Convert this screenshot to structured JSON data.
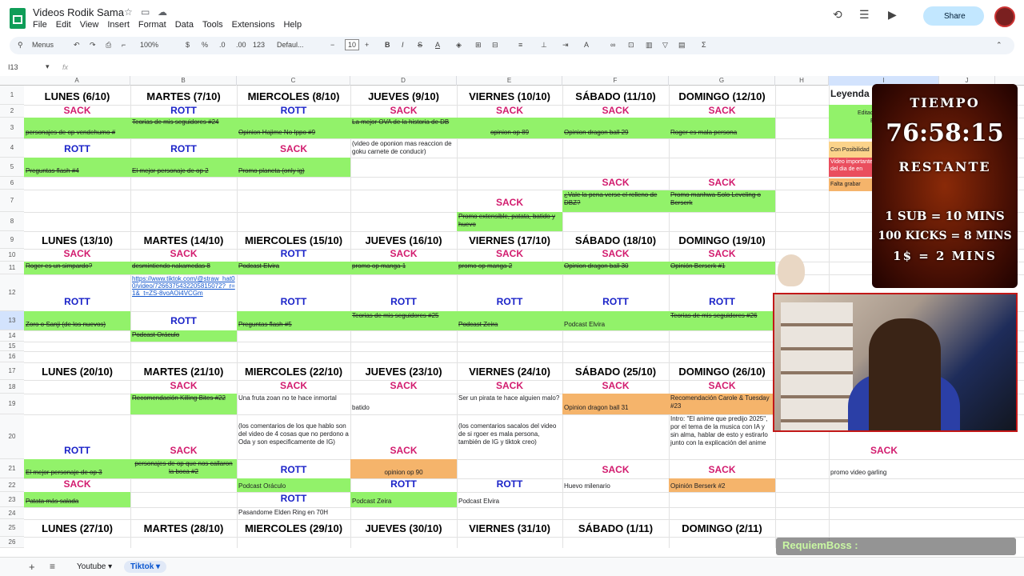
{
  "app": {
    "title": "Videos Rodik Sama",
    "menu": [
      "File",
      "Edit",
      "View",
      "Insert",
      "Format",
      "Data",
      "Tools",
      "Extensions",
      "Help"
    ],
    "share_label": "Share"
  },
  "toolbar": {
    "search": "Menus",
    "zoom": "100%",
    "currency": "$",
    "percent": "%",
    "dec1": ".0",
    "dec2": ".00",
    "numfmt": "123",
    "font": "Defaul...",
    "fontsize": "10"
  },
  "formula_bar": {
    "cell_ref": "I13",
    "fx": "fx"
  },
  "columns": [
    "A",
    "B",
    "C",
    "D",
    "E",
    "F",
    "G",
    "H",
    "I",
    "J"
  ],
  "rows": [
    "1",
    "2",
    "3",
    "4",
    "5",
    "6",
    "7",
    "8",
    "9",
    "10",
    "11",
    "12",
    "13",
    "14",
    "15",
    "16",
    "17",
    "18",
    "19",
    "20",
    "21",
    "22",
    "23",
    "24",
    "25",
    "26"
  ],
  "cells": {
    "r1": [
      "LUNES (6/10)",
      "MARTES (7/10)",
      "MIERCOLES (8/10)",
      "JUEVES (9/10)",
      "VIERNES (10/10)",
      "SÁBADO (11/10)",
      "DOMINGO (12/10)"
    ],
    "r2": [
      "SACK",
      "ROTT",
      "ROTT",
      "SACK",
      "SACK",
      "SACK",
      "SACK"
    ],
    "r3": [
      "personajes de op vendehumo #",
      "Teorias de mis seguidores #24",
      "Opinion Hajime No Ippo #9",
      "La mejor OVA de la historia de DB",
      "opinion op 89",
      "Opinion dragon ball 29",
      "Roger es mala persona"
    ],
    "r3_d_note": "(video de oponion mas reaccion de goku carnete de conducir)",
    "r4": [
      "ROTT",
      "ROTT",
      "SACK"
    ],
    "r5": [
      "Preguntas flash #4",
      "El mejor personaje de op 2",
      "Promo planeta  (only ig)"
    ],
    "r6": [
      "SACK",
      "SACK"
    ],
    "r7_e": "SACK",
    "r7_f": "¿Vale la pena verse el relleno de DBZ?",
    "r7_g": "Promo manhwa Solo Leveling o Berserk",
    "r8_e": "Promo extensible, patata, batido y huevo",
    "r9": [
      "LUNES (13/10)",
      "MARTES (14/10)",
      "MIERCOLES (15/10)",
      "JUEVES (16/10)",
      "VIERNES (17/10)",
      "SÁBADO (18/10)",
      "DOMINGO (19/10)"
    ],
    "r10": [
      "SACK",
      "SACK",
      "ROTT",
      "SACK",
      "SACK",
      "SACK",
      "SACK"
    ],
    "r11": [
      "Roger es un simpardo?",
      "desmintiendo nakamedas 8",
      "Podcast Elvira",
      "promo op manga 1",
      "promo op manga 2",
      "Opinion dragon ball 30",
      "Opinión Berserk #1"
    ],
    "r12_b_link": "https://www.tiktok.com/@straw_hat00/video/7266375432205815072?_r=1&_t=ZS-8voAOi4VCGm",
    "r12": [
      "ROTT",
      "",
      "ROTT",
      "ROTT",
      "ROTT",
      "ROTT",
      "ROTT"
    ],
    "r13": [
      "Zoro o Sanji (de los nuevos)",
      "ROTT",
      "Preguntas flash #5",
      "Teorias de mis seguidores #25",
      "Podcast Zeira",
      "Podcast Elvira",
      "Teorias de mis seguidores #26"
    ],
    "r14_b": "Podcast Oráculo",
    "r17": [
      "LUNES (20/10)",
      "MARTES (21/10)",
      "MIERCOLES (22/10)",
      "JUEVES (23/10)",
      "VIERNES (24/10)",
      "SÁBADO (25/10)",
      "DOMINGO (26/10)"
    ],
    "r18": [
      "SACK",
      "SACK",
      "SACK",
      "SACK",
      "SACK",
      "SACK"
    ],
    "r19": [
      "Recomendación Killing Bites #22",
      "Una fruta zoan no te hace inmortal",
      "batido",
      "Ser un pirata te hace alguien malo?",
      "Opinion dragon ball 31",
      "Recomendación Carole & Tuesday #23"
    ],
    "r20_c": "(los comentarios de los que hablo son del video de 4 cosas que no perdono a Oda y son especificamente de IG)",
    "r20_e": "(los comentarios sacalos del video de si rgoer es mala persona, también de IG y tiktok creo)",
    "r20_g": "Intro: \"El anime que predijo 2025\", por el tema de la musica con IA y sin alma, hablar de esto y estirarlo junto con la explicación del anime",
    "r20": [
      "ROTT",
      "SACK",
      "SACK"
    ],
    "r20_i": "SACK",
    "r21": [
      "El mejor personaje de op 3",
      "personajes de op que nos callaron la boca #2",
      "ROTT",
      "opinion op 90",
      "SACK",
      "SACK"
    ],
    "r21_i": "promo video garling",
    "r22": [
      "SACK",
      "Podcast Oráculo",
      "ROTT",
      "ROTT",
      "Huevo milenario",
      "Opinión Berserk #2"
    ],
    "r23": [
      "Patata más salada",
      "ROTT",
      "Podcast Zeira",
      "Podcast Elvira"
    ],
    "r24_c": "Pasandome Elden Ring en 70H",
    "r25": [
      "LUNES (27/10)",
      "MARTES (28/10)",
      "MIERCOLES (29/10)",
      "JUEVES (30/10)",
      "VIERNES (31/10)",
      "SÁBADO (1/11)",
      "DOMINGO (2/11)"
    ]
  },
  "legend": {
    "title": "Leyenda",
    "items": [
      "Editado",
      "Ed",
      "Con Posibilidad",
      "Video importante fallo del dia de en",
      "Falta grabar"
    ]
  },
  "stream": {
    "tiempo_label": "TIEMPO",
    "timer": "76:58:15",
    "restante": "RESTANTE",
    "line1": "1 SUB = 10 MINS",
    "line2": "100 KICKS = 8 MINS",
    "line3": "1$ = 2 MINS"
  },
  "chat": {
    "text": "RequiemBoss :"
  },
  "sheet_tabs": [
    "Youtube",
    "Tiktok"
  ],
  "colors": {
    "green": "#92f26a",
    "orange": "#f5b46b",
    "sack": "#d21b6e",
    "rott": "#1a22c8"
  }
}
